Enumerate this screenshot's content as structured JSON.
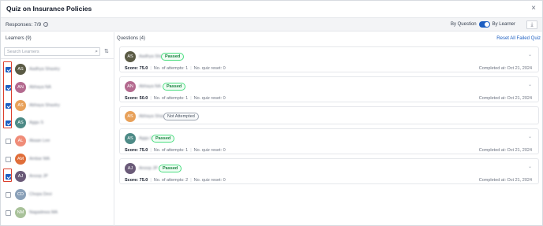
{
  "window": {
    "title": "Quiz on Insurance Policies",
    "close_glyph": "×"
  },
  "toolbar": {
    "responses_label": "Responses: 7/9",
    "by_question": "By Question",
    "by_learner": "By Learner",
    "toggle_state": "by_learner",
    "download_glyph": "⤓"
  },
  "learners": {
    "header": "Learners  (9)",
    "search_placeholder": "Search Learners",
    "items": [
      {
        "initials": "AS",
        "name": "Aadhya Shastry",
        "color": "#5b5b45",
        "checked": true
      },
      {
        "initials": "AN",
        "name": "Abhaya NA",
        "color": "#b46a8f",
        "checked": true
      },
      {
        "initials": "AS",
        "name": "Abhaya Shastry",
        "color": "#e8a15a",
        "checked": true
      },
      {
        "initials": "AS",
        "name": "Aggu S",
        "color": "#4d8a86",
        "checked": true
      },
      {
        "initials": "AL",
        "name": "Akaan Lee",
        "color": "#f08c78",
        "checked": false
      },
      {
        "initials": "AM",
        "name": "Ambar MA",
        "color": "#e06e3a",
        "checked": false
      },
      {
        "initials": "AJ",
        "name": "Anoop JP",
        "color": "#6a5a78",
        "checked": true
      },
      {
        "initials": "CD",
        "name": "Chopa Devi",
        "color": "#8aa0b8",
        "checked": false
      },
      {
        "initials": "NM",
        "name": "Nagadewa MA",
        "color": "#a9c29a",
        "checked": false
      }
    ]
  },
  "questions": {
    "header": "Questions  (4)",
    "reset_all": "Reset All Failed Quiz",
    "cards": [
      {
        "initials": "AS",
        "name": "Aadhya Shastry",
        "color": "#5b5b45",
        "status": "Passed",
        "score": "Score: 75.0",
        "attempts": "No. of attempts: 1",
        "reset": "No. quiz reset: 0",
        "completed": "Completed at: Oct 21, 2024"
      },
      {
        "initials": "AN",
        "name": "Abhaya NA",
        "color": "#b46a8f",
        "status": "Passed",
        "score": "Score: 50.0",
        "attempts": "No. of attempts: 1",
        "reset": "No. quiz reset: 0",
        "completed": "Completed at: Oct 21, 2024"
      },
      {
        "initials": "AS",
        "name": "Abhaya Shastry",
        "color": "#e8a15a",
        "status": "Not Attempted"
      },
      {
        "initials": "AS",
        "name": "Aggu S",
        "color": "#4d8a86",
        "status": "Passed",
        "score": "Score: 75.0",
        "attempts": "No. of attempts: 1",
        "reset": "No. quiz reset: 0",
        "completed": "Completed at: Oct 21, 2024"
      },
      {
        "initials": "AJ",
        "name": "Anoop JP",
        "color": "#6a5a78",
        "status": "Passed",
        "score": "Score: 75.0",
        "attempts": "No. of attempts: 2",
        "reset": "No. quiz reset: 0",
        "completed": "Completed at: Oct 21, 2024"
      }
    ]
  }
}
